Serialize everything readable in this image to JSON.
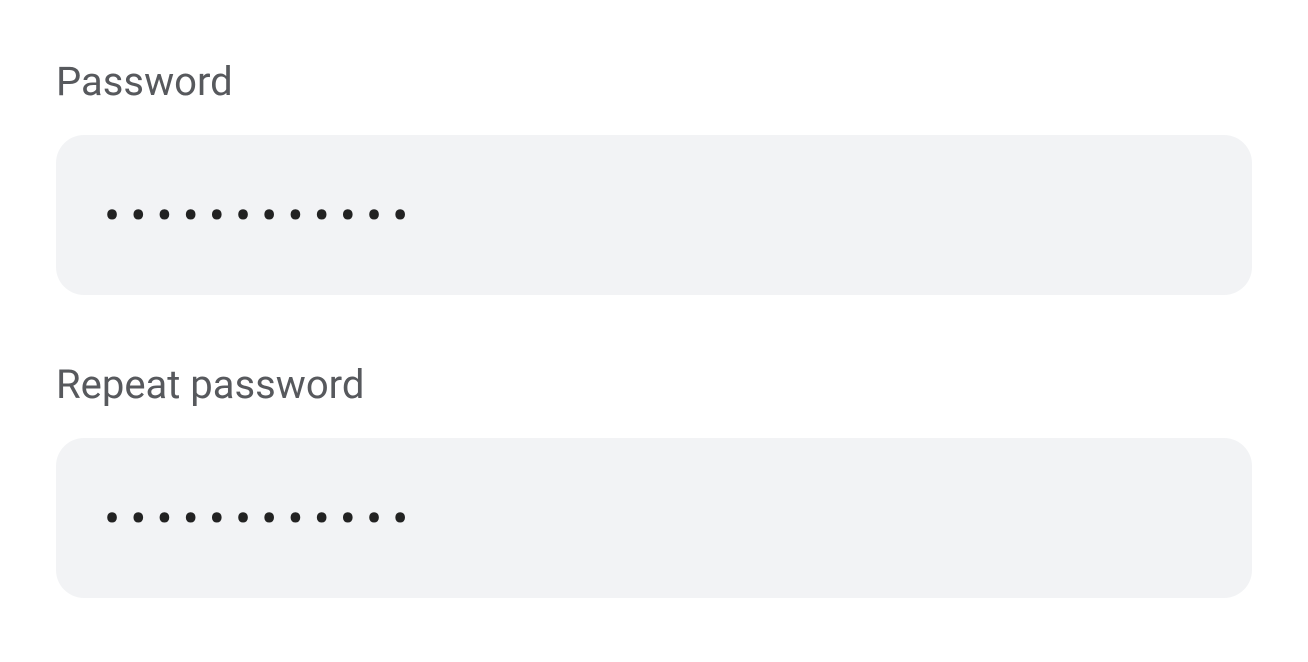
{
  "form": {
    "password": {
      "label": "Password",
      "value": "••••••••••••"
    },
    "repeat_password": {
      "label": "Repeat password",
      "value": "••••••••••••"
    }
  }
}
